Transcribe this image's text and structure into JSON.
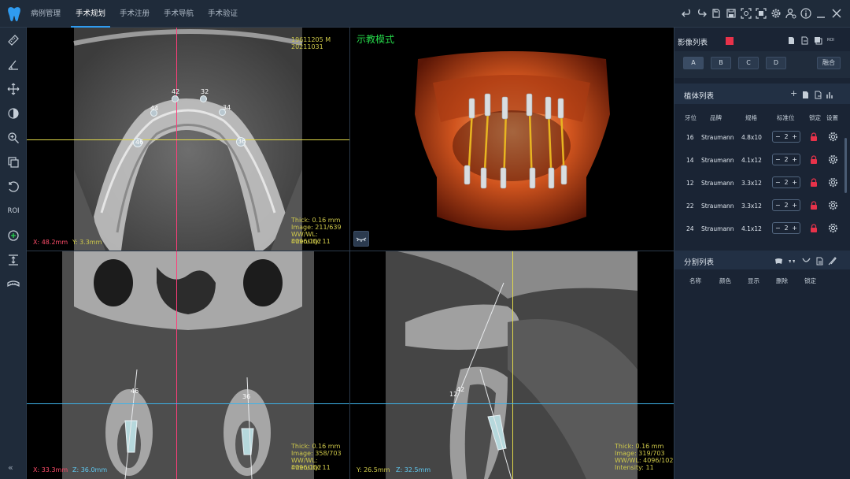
{
  "menu": {
    "tabs": [
      {
        "label": "病例管理"
      },
      {
        "label": "手术规划"
      },
      {
        "label": "手术注册"
      },
      {
        "label": "手术导航"
      },
      {
        "label": "手术验证"
      }
    ],
    "active_tab": 1
  },
  "toolbar_icons": [
    "undo-icon",
    "redo-icon",
    "reset-icon",
    "save-icon",
    "screenshot-icon",
    "fit-screen-icon",
    "settings-icon",
    "user-settings-icon",
    "info-icon",
    "minimize-icon",
    "close-icon"
  ],
  "left_tools": [
    "ruler-icon",
    "angle-icon",
    "move-icon",
    "contrast-icon",
    "zoom-icon",
    "layers-icon",
    "rotate-icon",
    "roi-tool",
    "crosshair-icon",
    "slice-thickness-icon",
    "panoramic-icon"
  ],
  "left_tools_roi_label": "ROI",
  "left_collapse_label": "«",
  "viewports": {
    "axial": {
      "patient_id": "19611205 M",
      "date": "20211031",
      "thick": "Thick: 0.16 mm",
      "image": "Image: 211/639",
      "wwwl": "WW/WL: 4096/102",
      "intensity": "Intensity: 11",
      "coord_x": "X: 48.2mm",
      "coord_y": "Y: 3.3mm",
      "tooth_labels": [
        "42",
        "32",
        "44",
        "34",
        "46",
        "36"
      ]
    },
    "render3d": {
      "mode_label": "示教模式"
    },
    "coronal": {
      "thick": "Thick: 0.16 mm",
      "image": "Image: 358/703",
      "wwwl": "WW/WL: 4096/102",
      "intensity": "Intensity: 11",
      "coord_x": "X: 33.3mm",
      "coord_z": "Z: 36.0mm",
      "tooth_labels": [
        "46",
        "36"
      ]
    },
    "sagittal": {
      "thick": "Thick: 0.16 mm",
      "image": "Image: 319/703",
      "wwwl": "WW/WL: 4096/102",
      "intensity": "Intensity: 11",
      "coord_y": "Y: 26.5mm",
      "coord_z": "Z: 32.5mm",
      "tooth_labels": [
        "12",
        "42"
      ]
    }
  },
  "right_panel": {
    "image_list_title": "影像列表",
    "roi_icon_label": "ROI",
    "view_buttons": [
      "A",
      "B",
      "C",
      "D"
    ],
    "fuse_button": "融合",
    "implant_list_title": "植体列表",
    "implant_headers": [
      "牙位",
      "品牌",
      "规格",
      "标准位",
      "锁定",
      "设置"
    ],
    "implants": [
      {
        "tooth": "16",
        "brand": "Straumann",
        "spec": "4.8x10",
        "std": "2"
      },
      {
        "tooth": "14",
        "brand": "Straumann",
        "spec": "4.1x12",
        "std": "2"
      },
      {
        "tooth": "12",
        "brand": "Straumann",
        "spec": "3.3x12",
        "std": "2"
      },
      {
        "tooth": "22",
        "brand": "Straumann",
        "spec": "3.3x12",
        "std": "2"
      },
      {
        "tooth": "24",
        "brand": "Straumann",
        "spec": "4.1x12",
        "std": "2"
      }
    ],
    "stepper_minus": "−",
    "stepper_plus": "+",
    "segment_list_title": "分割列表",
    "segment_headers": [
      "名称",
      "颜色",
      "显示",
      "删除",
      "锁定"
    ]
  },
  "colors": {
    "accent": "#2f9bf0",
    "lock_red": "#e8324a",
    "crosshair_pink": "#ff3d7a",
    "crosshair_yellow": "#e0d84a",
    "crosshair_blue": "#3db2e8",
    "overlay_text_yellow": "#cfc94a",
    "mode_green": "#26d84a"
  }
}
